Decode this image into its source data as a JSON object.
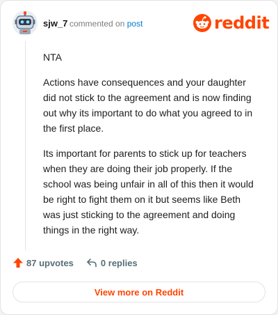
{
  "comment": {
    "username": "sjw_7",
    "action_text": "commented on",
    "post_link_text": "post",
    "paragraphs": [
      "NTA",
      "Actions have consequences and your daughter did not stick to the agreement and is now finding out why its important to do what you agreed to in the first place.",
      "Its important for parents to stick up for teachers when they are doing their job properly. If the school was being unfair in all of this then it would be right to fight them on it but seems like Beth was just sticking to the agreement and doing things in the right way."
    ]
  },
  "brand": {
    "logo_text": "reddit",
    "accent_color": "#ff4500",
    "icon": "reddit-snoo-icon"
  },
  "footer": {
    "upvotes_label": "87 upvotes",
    "upvote_icon": "upvote-arrow-icon",
    "replies_label": "0 replies",
    "reply_icon": "reply-arrow-icon",
    "view_more_label": "View more on Reddit"
  },
  "avatar": {
    "icon": "robot-avatar-icon"
  }
}
